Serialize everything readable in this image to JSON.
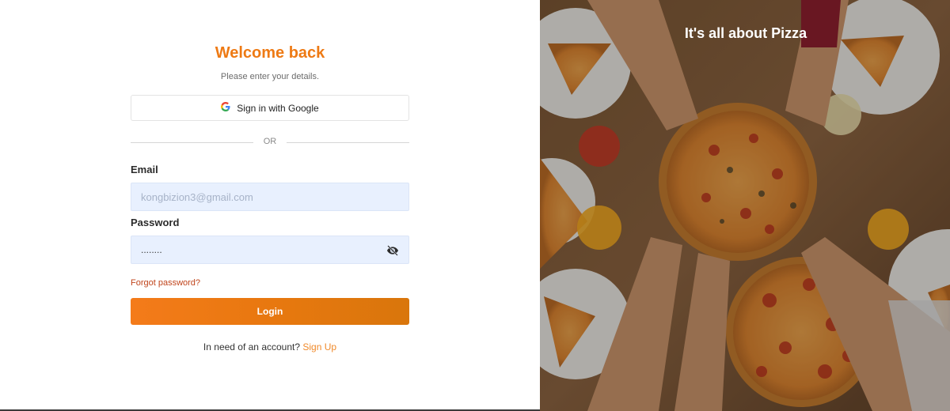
{
  "form": {
    "title": "Welcome back",
    "subtitle": "Please enter your details.",
    "google_button_label": "Sign in with Google",
    "divider_text": "OR",
    "email_label": "Email",
    "email_placeholder": "kongbizion3@gmail.com",
    "password_label": "Password",
    "password_value": "........",
    "forgot_password": "Forgot password?",
    "login_button": "Login",
    "signup_prompt": "In need of an account?",
    "signup_link": "Sign Up"
  },
  "hero": {
    "title": "It's all about Pizza",
    "image": "pizza-table-photo"
  },
  "colors": {
    "accent": "#ee7a14",
    "link": "#c0441b",
    "input_bg": "#e8f0fe"
  },
  "icons": [
    "google-icon",
    "eye-off-icon"
  ]
}
